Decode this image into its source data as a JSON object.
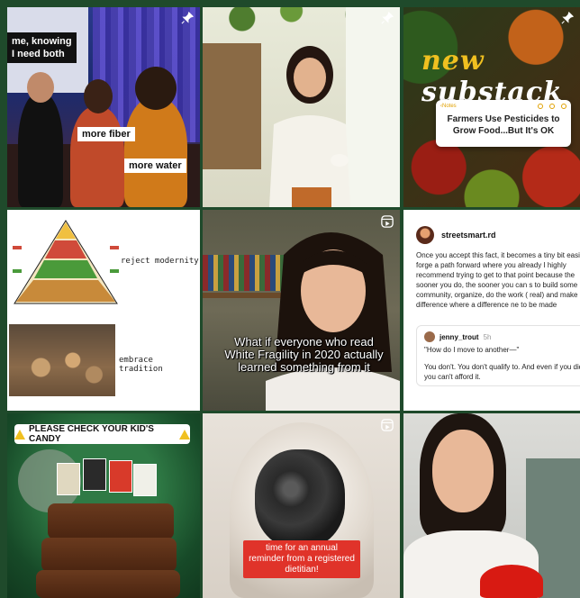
{
  "tiles": [
    {
      "id": 1,
      "type": "photo",
      "pinned": true,
      "labels": [
        "me, knowing",
        "I need both",
        "more fiber",
        "more water"
      ]
    },
    {
      "id": 2,
      "type": "photo",
      "pinned": true
    },
    {
      "id": 3,
      "type": "photo",
      "pinned": true,
      "title_part1": "new",
      "title_part2": "substack",
      "note_header": "Notes",
      "note_text": "Farmers Use Pesticides to Grow Food...But It's OK"
    },
    {
      "id": 4,
      "type": "meme",
      "caption_top": "reject modernity",
      "caption_bottom": "embrace tradition"
    },
    {
      "id": 5,
      "type": "reel",
      "caption": "What if everyone who read White Fragility in 2020 actually learned something from it"
    },
    {
      "id": 6,
      "type": "text-post",
      "username": "streetsmart.rd",
      "body": "Once you accept this fact, it becomes a tiny bit easier to forge a path forward where you already I highly recommend trying to get to that point because the sooner you do, the sooner you can s to build some community, organize, do the work ( real) and make a difference where a difference ne to be made",
      "reply_user": "jenny_trout",
      "reply_time": "5h",
      "reply_quote": "\"How do I move to another—\"",
      "reply_answer": "You don't. You don't qualify to. And even if you did, you can't afford it."
    },
    {
      "id": 7,
      "type": "photo",
      "banner": "PLEASE CHECK YOUR KID'S CANDY"
    },
    {
      "id": 8,
      "type": "reel",
      "caption": "time for an annual reminder from a registered dietitian!"
    },
    {
      "id": 9,
      "type": "photo"
    }
  ],
  "colors": {
    "background": "#1f4a2b",
    "accent_red": "#e0332a",
    "note_yellow": "#e0a000"
  }
}
